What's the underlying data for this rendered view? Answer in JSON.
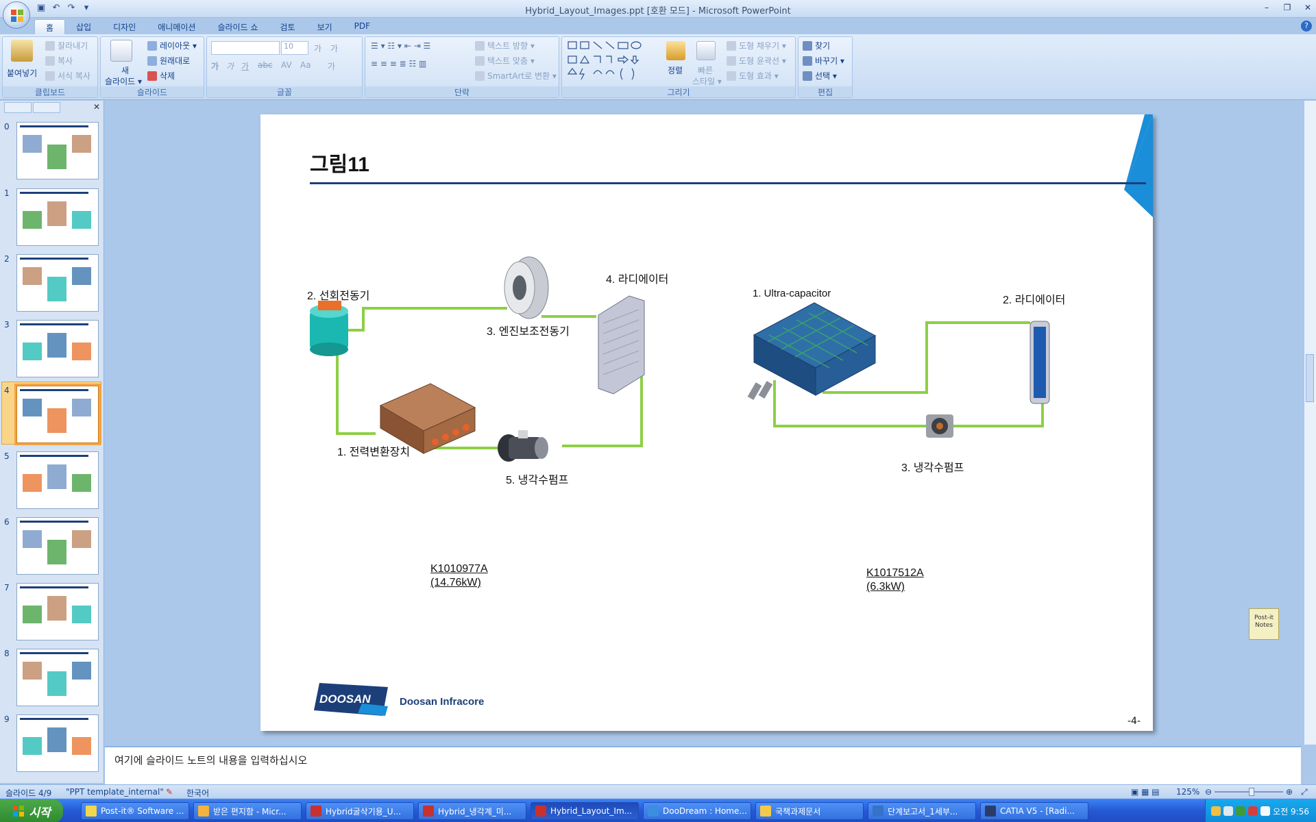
{
  "window": {
    "title": "Hybrid_Layout_Images.ppt [호환 모드] - Microsoft PowerPoint"
  },
  "ribbon": {
    "tabs": [
      "홈",
      "삽입",
      "디자인",
      "애니메이션",
      "슬라이드 쇼",
      "검토",
      "보기",
      "PDF"
    ],
    "clipboard": {
      "label": "클립보드",
      "paste": "붙여넣기",
      "cut": "잘라내기",
      "copy": "복사",
      "format_painter": "서식 복사"
    },
    "slides": {
      "label": "슬라이드",
      "new_slide_1": "새",
      "new_slide_2": "슬라이드 ▾",
      "layout": "레이아웃 ▾",
      "reset": "원래대로",
      "delete": "삭제"
    },
    "font": {
      "label": "글꼴",
      "size": "10",
      "bold": "가",
      "grow": "가",
      "shrink": "가",
      "italic": "가",
      "underline": "가",
      "strike": "abc",
      "spacing": "AV",
      "case": "Aa",
      "color": "가"
    },
    "paragraph": {
      "label": "단락",
      "text_direction": "텍스트 방향 ▾",
      "align_text": "텍스트 맞춤 ▾",
      "smartart": "SmartArt로 변환 ▾"
    },
    "drawing": {
      "label": "그리기",
      "arrange": "정렬",
      "quick_styles_1": "빠른",
      "quick_styles_2": "스타일 ▾",
      "shape_fill": "도형 채우기 ▾",
      "shape_outline": "도형 윤곽선 ▾",
      "shape_effects": "도형 효과 ▾"
    },
    "editing": {
      "label": "편집",
      "find": "찾기",
      "replace": "바꾸기 ▾",
      "select": "선택 ▾"
    }
  },
  "thumbnails": [
    {
      "num": "0"
    },
    {
      "num": "1"
    },
    {
      "num": "2"
    },
    {
      "num": "3"
    },
    {
      "num": "4"
    },
    {
      "num": "5"
    },
    {
      "num": "6"
    },
    {
      "num": "7"
    },
    {
      "num": "8"
    },
    {
      "num": "9"
    }
  ],
  "slide": {
    "title": "그림11",
    "left": {
      "motor": "2. 선회전동기",
      "aux_motor": "3. 엔진보조전동기",
      "radiator": "4. 라디에이터",
      "inverter": "1. 전력변환장치",
      "pump": "5. 냉각수펌프",
      "part_no": "K1010977A",
      "part_power": "(14.76kW)"
    },
    "right": {
      "ucap": "1. Ultra-capacitor",
      "radiator": "2. 라디에이터",
      "pump": "3. 냉각수펌프",
      "part_no": "K1017512A",
      "part_power": "(6.3kW)"
    },
    "logo_text": "DOOSAN",
    "company": "Doosan Infracore",
    "page": "-4-"
  },
  "notes": {
    "placeholder": "여기에 슬라이드 노트의 내용을 입력하십시오"
  },
  "postit": {
    "line1": "Post-it",
    "line2": "Notes"
  },
  "status": {
    "slide": "슬라이드 4/9",
    "theme": "\"PPT template_internal\"",
    "language": "한국어",
    "zoom": "125%"
  },
  "taskbar": {
    "start": "시작",
    "items": [
      {
        "label": "Post-it® Software ...",
        "color": "#f2d64b"
      },
      {
        "label": "받은 편지함 - Micr...",
        "color": "#f3b33d"
      },
      {
        "label": "Hybrid굴삭기용_U...",
        "color": "#c8312e"
      },
      {
        "label": "Hybrid_냉각계_미...",
        "color": "#c8312e"
      },
      {
        "label": "Hybrid_Layout_Im...",
        "color": "#c8312e",
        "active": true
      },
      {
        "label": "DooDream : Home...",
        "color": "#3b8de0"
      },
      {
        "label": "국책과제문서",
        "color": "#f3c94b"
      },
      {
        "label": "단계보고서_1세부...",
        "color": "#3572c8"
      },
      {
        "label": "CATIA V5 - [Radi...",
        "color": "#2b3c6b"
      }
    ],
    "clock": "오전 9:56"
  },
  "colors": {
    "pipe": "#8dcf45",
    "accent_blue": "#1a8ed8",
    "title_rule": "#1c3f7a"
  }
}
